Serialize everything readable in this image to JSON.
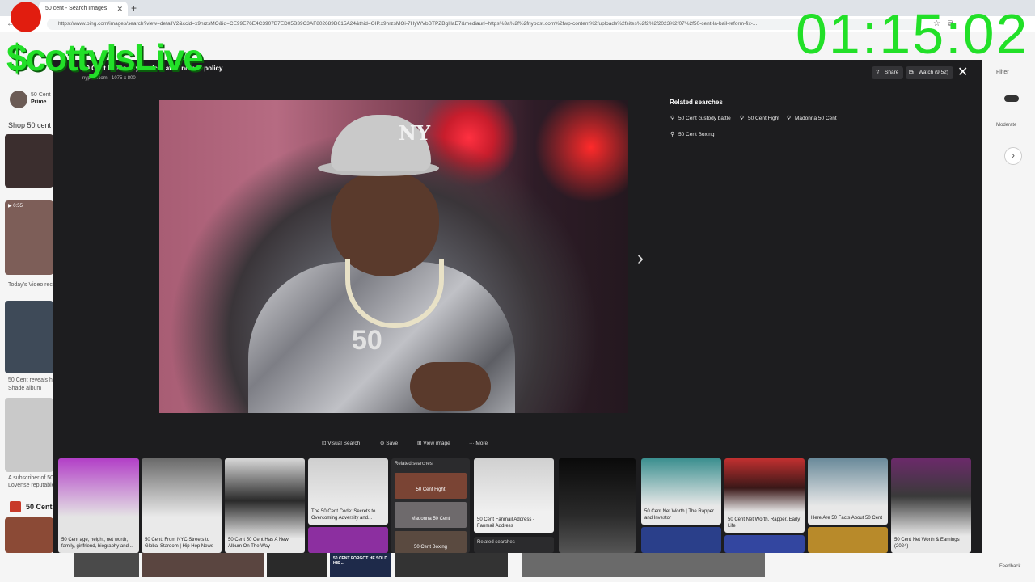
{
  "browser": {
    "tab_title": "50 cent - Search Images",
    "tab_close": "✕",
    "new_tab": "+",
    "url": "https://www.bing.com/images/search?view=detailV2&ccid=x9hrzsMO&id=CE99E76E4C3907B7ED05B39C3AF802689D615A24&thid=OIP.x9hrzsMOi-7HyWVbBTPZBgHaE7&mediaurl=https%3a%2f%2fnypost.com%2fwp-content%2fuploads%2fsites%2f2%2f2023%2f07%2f50-cent-la-bail-reform-fix-..."
  },
  "background_page": {
    "prime_label": "50 Cent",
    "prime_sub": "Prime",
    "shop_label": "Shop 50 cent",
    "video_badge": "▶ 0:55",
    "texts": [
      "Today's Video recor...",
      "50 Cent reveals he...",
      "Shade album",
      "A subscriber of 50...",
      "Lovense reputable...",
      "50 Cent"
    ],
    "filter_label": "Filter",
    "safe_label": "Moderate",
    "feedback": "Feedback"
  },
  "overlay": {
    "title": "50 Cent blasts city leaders after no bail policy",
    "sub": "nypost.com  ·  1075 x 800",
    "share_label": "Share",
    "watch_label": "Watch (9:52)",
    "close_icon": "✕",
    "next_icon": "›",
    "image_caption": "50",
    "cap_logo": "NY",
    "actions": {
      "visual_search": "Visual Search",
      "save": "Save",
      "view_image": "View image",
      "more": "More"
    },
    "related_title": "Related searches",
    "related_chips": [
      "50 Cent custody battle",
      "50 Cent Fight",
      "Madonna 50 Cent",
      "50 Cent Boxing"
    ]
  },
  "thumbnails": [
    {
      "caption": "50 Cent age, height, net worth, family, girlfriend, biography and..."
    },
    {
      "caption": "50 Cent: From NYC Streets to Global Stardom | Hip Hop News"
    },
    {
      "caption": "50 Cent 50 Cent Has A New Album On The Way"
    },
    {
      "caption": "The 50 Cent Code: Secrets to Overcoming Adversity and..."
    },
    {
      "caption": "Related searches"
    },
    {
      "caption": "50 Cent Fight"
    },
    {
      "caption": "Madonna 50 Cent"
    },
    {
      "caption": "50 Cent Boxing"
    },
    {
      "caption": "50 Cent Fanmail Address - Fanmail Address"
    },
    {
      "caption": "Related searches"
    },
    {
      "caption": "50 Cent Net Worth | The Rapper and Investor"
    },
    {
      "caption": "50 Cent Net Worth, Rapper, Early Life"
    },
    {
      "caption": "Here Are 50 Facts About 50 Cent"
    },
    {
      "caption": "50 Cent Net Worth & Earnings (2024)"
    }
  ],
  "bottom_strip": {
    "news_text": "50 CENT FORGOT HE SOLD HIS ..."
  },
  "streamer": {
    "logo": "$cottyIsLive",
    "timer": "01:15:02"
  },
  "colors": {
    "overlay_bg": "#1d1d1f",
    "accent_green": "#22e028",
    "rec_red": "#e11d0f"
  }
}
